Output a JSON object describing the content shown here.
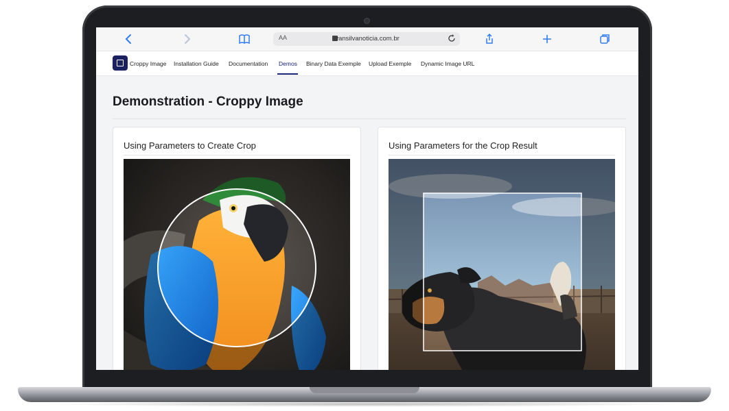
{
  "browser": {
    "aa_label": "AA",
    "url": "ivansilvanoticia.com.br",
    "icons": [
      "back-icon",
      "forward-icon",
      "book-icon",
      "lock-icon",
      "reload-icon",
      "share-icon",
      "new-tab-icon",
      "tabs-icon"
    ]
  },
  "nav": {
    "brand": "Croppy Image",
    "items": [
      "Installation Guide",
      "Documentation",
      "Demos",
      "Binary Data Exemple",
      "Upload Exemple",
      "Dynamic Image URL"
    ],
    "active": "Demos"
  },
  "page": {
    "title": "Demonstration - Croppy Image"
  },
  "cards": [
    {
      "title": "Using Parameters to Create Crop"
    },
    {
      "title": "Using Parameters for the Crop Result"
    }
  ],
  "colors": {
    "brand": "#1b2060",
    "accent": "#1a237e",
    "browser_icon": "#2f7cf6"
  }
}
